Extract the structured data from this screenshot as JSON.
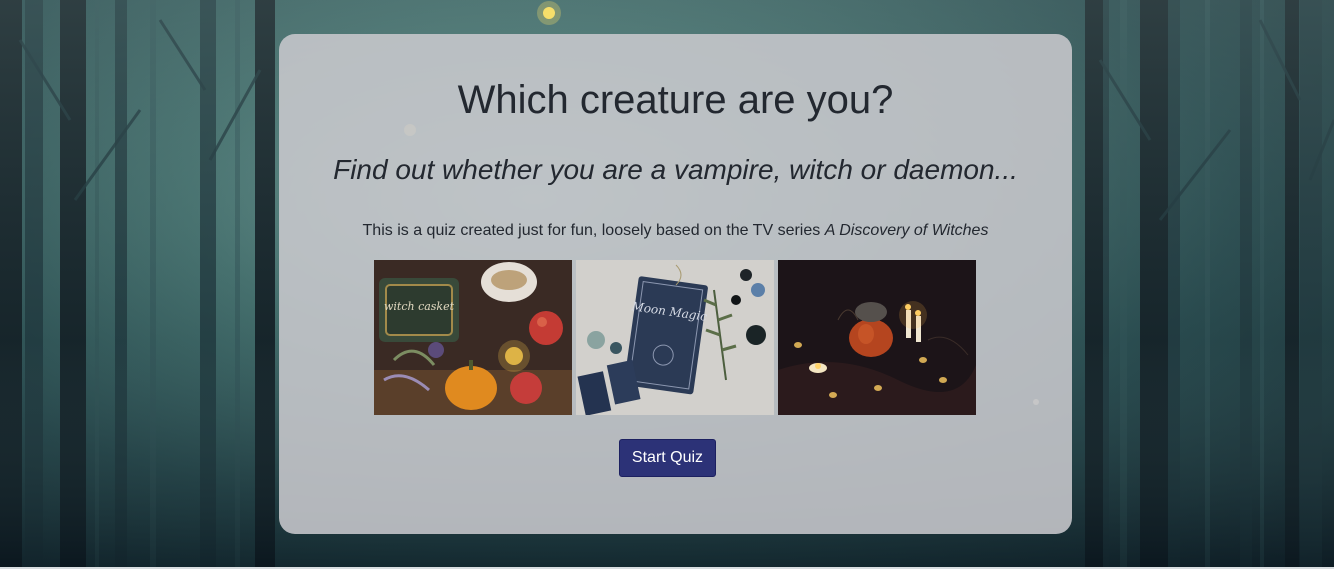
{
  "page": {
    "background": "misty dark forest",
    "accent_color": "#2c3277",
    "card_color": "#c8c8cd"
  },
  "quiz": {
    "title": "Which creature are you?",
    "subtitle": "Find out whether you are a vampire, witch or daemon...",
    "description_text": "This is a quiz created just for fun, loosely based on the TV series ",
    "description_show": "A Discovery of Witches",
    "images": [
      {
        "icon": "witch-casket-photo",
        "book_text": "witch casket"
      },
      {
        "icon": "moon-magic-book-photo",
        "book_text": "Moon Magic"
      },
      {
        "icon": "candles-pumpkin-photo"
      }
    ],
    "start_button": "Start Quiz"
  }
}
